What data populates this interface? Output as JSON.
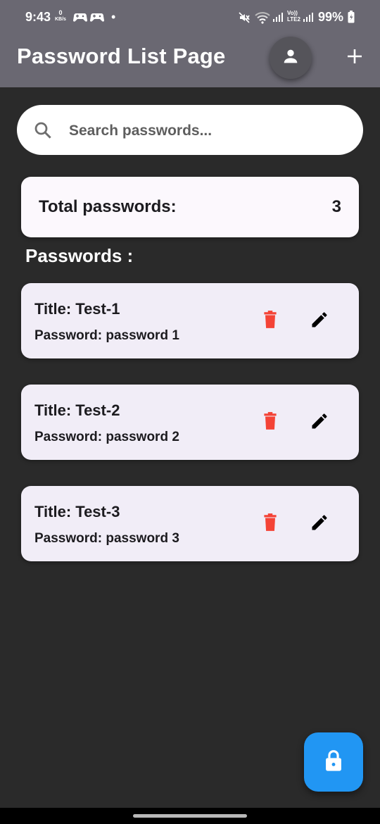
{
  "status_bar": {
    "time": "9:43",
    "net_speed_value": "0",
    "net_speed_unit": "KB/s",
    "network_label_top": "Vo))",
    "network_label_bottom": "LTE2",
    "battery_percent": "99%"
  },
  "app_bar": {
    "title": "Password List Page"
  },
  "search": {
    "placeholder": "Search passwords..."
  },
  "summary": {
    "label": "Total passwords:",
    "count": "3"
  },
  "section_heading": "Passwords :",
  "passwords": [
    {
      "title": "Title: Test-1",
      "password": "Password: password 1"
    },
    {
      "title": "Title: Test-2",
      "password": "Password: password 2"
    },
    {
      "title": "Title: Test-3",
      "password": "Password: password 3"
    }
  ],
  "colors": {
    "app_bar": "#6a6872",
    "background": "#2a2a2a",
    "card": "#f1edf7",
    "delete_icon": "#f44336",
    "fab": "#2196f3"
  },
  "icons": {
    "avatar": "person-icon",
    "add": "plus-icon",
    "search": "search-icon",
    "delete": "trash-icon",
    "edit": "pencil-icon",
    "fab": "lock-icon"
  }
}
